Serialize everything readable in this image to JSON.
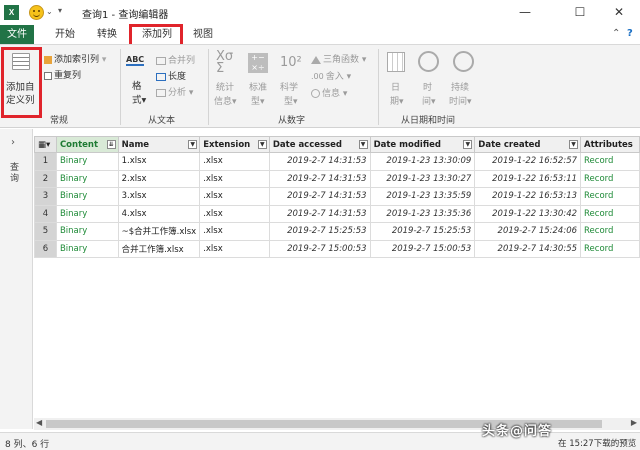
{
  "window": {
    "title": "查询1 - 查询编辑器",
    "app_badge": "X",
    "minimize": "—",
    "maximize": "☐",
    "close": "✕"
  },
  "tabs": [
    {
      "label": "文件"
    },
    {
      "label": "开始"
    },
    {
      "label": "转换"
    },
    {
      "label": "添加列"
    },
    {
      "label": "视图"
    }
  ],
  "ribbon": {
    "general": {
      "add_custom_col_line1": "添加自",
      "add_custom_col_line2": "定义列",
      "add_index_col": "添加索引列",
      "duplicate_col": "重复列",
      "label": "常规"
    },
    "text": {
      "format": "格",
      "format2": "式",
      "merge_cols": "合并列",
      "length": "长度",
      "analyze": "分析",
      "label": "从文本",
      "abc": "ABC"
    },
    "number": {
      "stats": "统计",
      "stats2": "信息",
      "standard": "标准",
      "standard2": "型",
      "scientific": "科学",
      "scientific2": "型",
      "trig": "三角函数",
      "rounding": "舍入",
      "info": "信息",
      "label": "从数字"
    },
    "datetime": {
      "date": "日",
      "date2": "期",
      "time": "时",
      "time2": "间",
      "duration": "持续",
      "duration2": "时间",
      "label": "从日期和时间"
    }
  },
  "side_panel": {
    "label": "查询"
  },
  "grid": {
    "columns": [
      "Content",
      "Name",
      "Extension",
      "Date accessed",
      "Date modified",
      "Date created",
      "Attributes"
    ],
    "rows": [
      {
        "idx": "1",
        "content": "Binary",
        "name": "1.xlsx",
        "ext": ".xlsx",
        "accessed": "2019-2-7 14:31:53",
        "modified": "2019-1-23 13:30:09",
        "created": "2019-1-22 16:52:57",
        "attr": "Record"
      },
      {
        "idx": "2",
        "content": "Binary",
        "name": "2.xlsx",
        "ext": ".xlsx",
        "accessed": "2019-2-7 14:31:53",
        "modified": "2019-1-23 13:30:27",
        "created": "2019-1-22 16:53:11",
        "attr": "Record"
      },
      {
        "idx": "3",
        "content": "Binary",
        "name": "3.xlsx",
        "ext": ".xlsx",
        "accessed": "2019-2-7 14:31:53",
        "modified": "2019-1-23 13:35:59",
        "created": "2019-1-22 16:53:13",
        "attr": "Record"
      },
      {
        "idx": "4",
        "content": "Binary",
        "name": "4.xlsx",
        "ext": ".xlsx",
        "accessed": "2019-2-7 14:31:53",
        "modified": "2019-1-23 13:35:36",
        "created": "2019-1-22 13:30:42",
        "attr": "Record"
      },
      {
        "idx": "5",
        "content": "Binary",
        "name": "~$合并工作簿.xlsx",
        "ext": ".xlsx",
        "accessed": "2019-2-7 15:25:53",
        "modified": "2019-2-7 15:25:53",
        "created": "2019-2-7 15:24:06",
        "attr": "Record"
      },
      {
        "idx": "6",
        "content": "Binary",
        "name": "合并工作簿.xlsx",
        "ext": ".xlsx",
        "accessed": "2019-2-7 15:00:53",
        "modified": "2019-2-7 15:00:53",
        "created": "2019-2-7 14:30:55",
        "attr": "Record"
      }
    ]
  },
  "status": {
    "left": "8 列、6 行",
    "right": "在 15:27下载的预览"
  },
  "watermark": "头条@问答",
  "colors": {
    "excel_green": "#217346",
    "highlight_red": "#e0242b",
    "binary_green": "#1e8a37"
  }
}
